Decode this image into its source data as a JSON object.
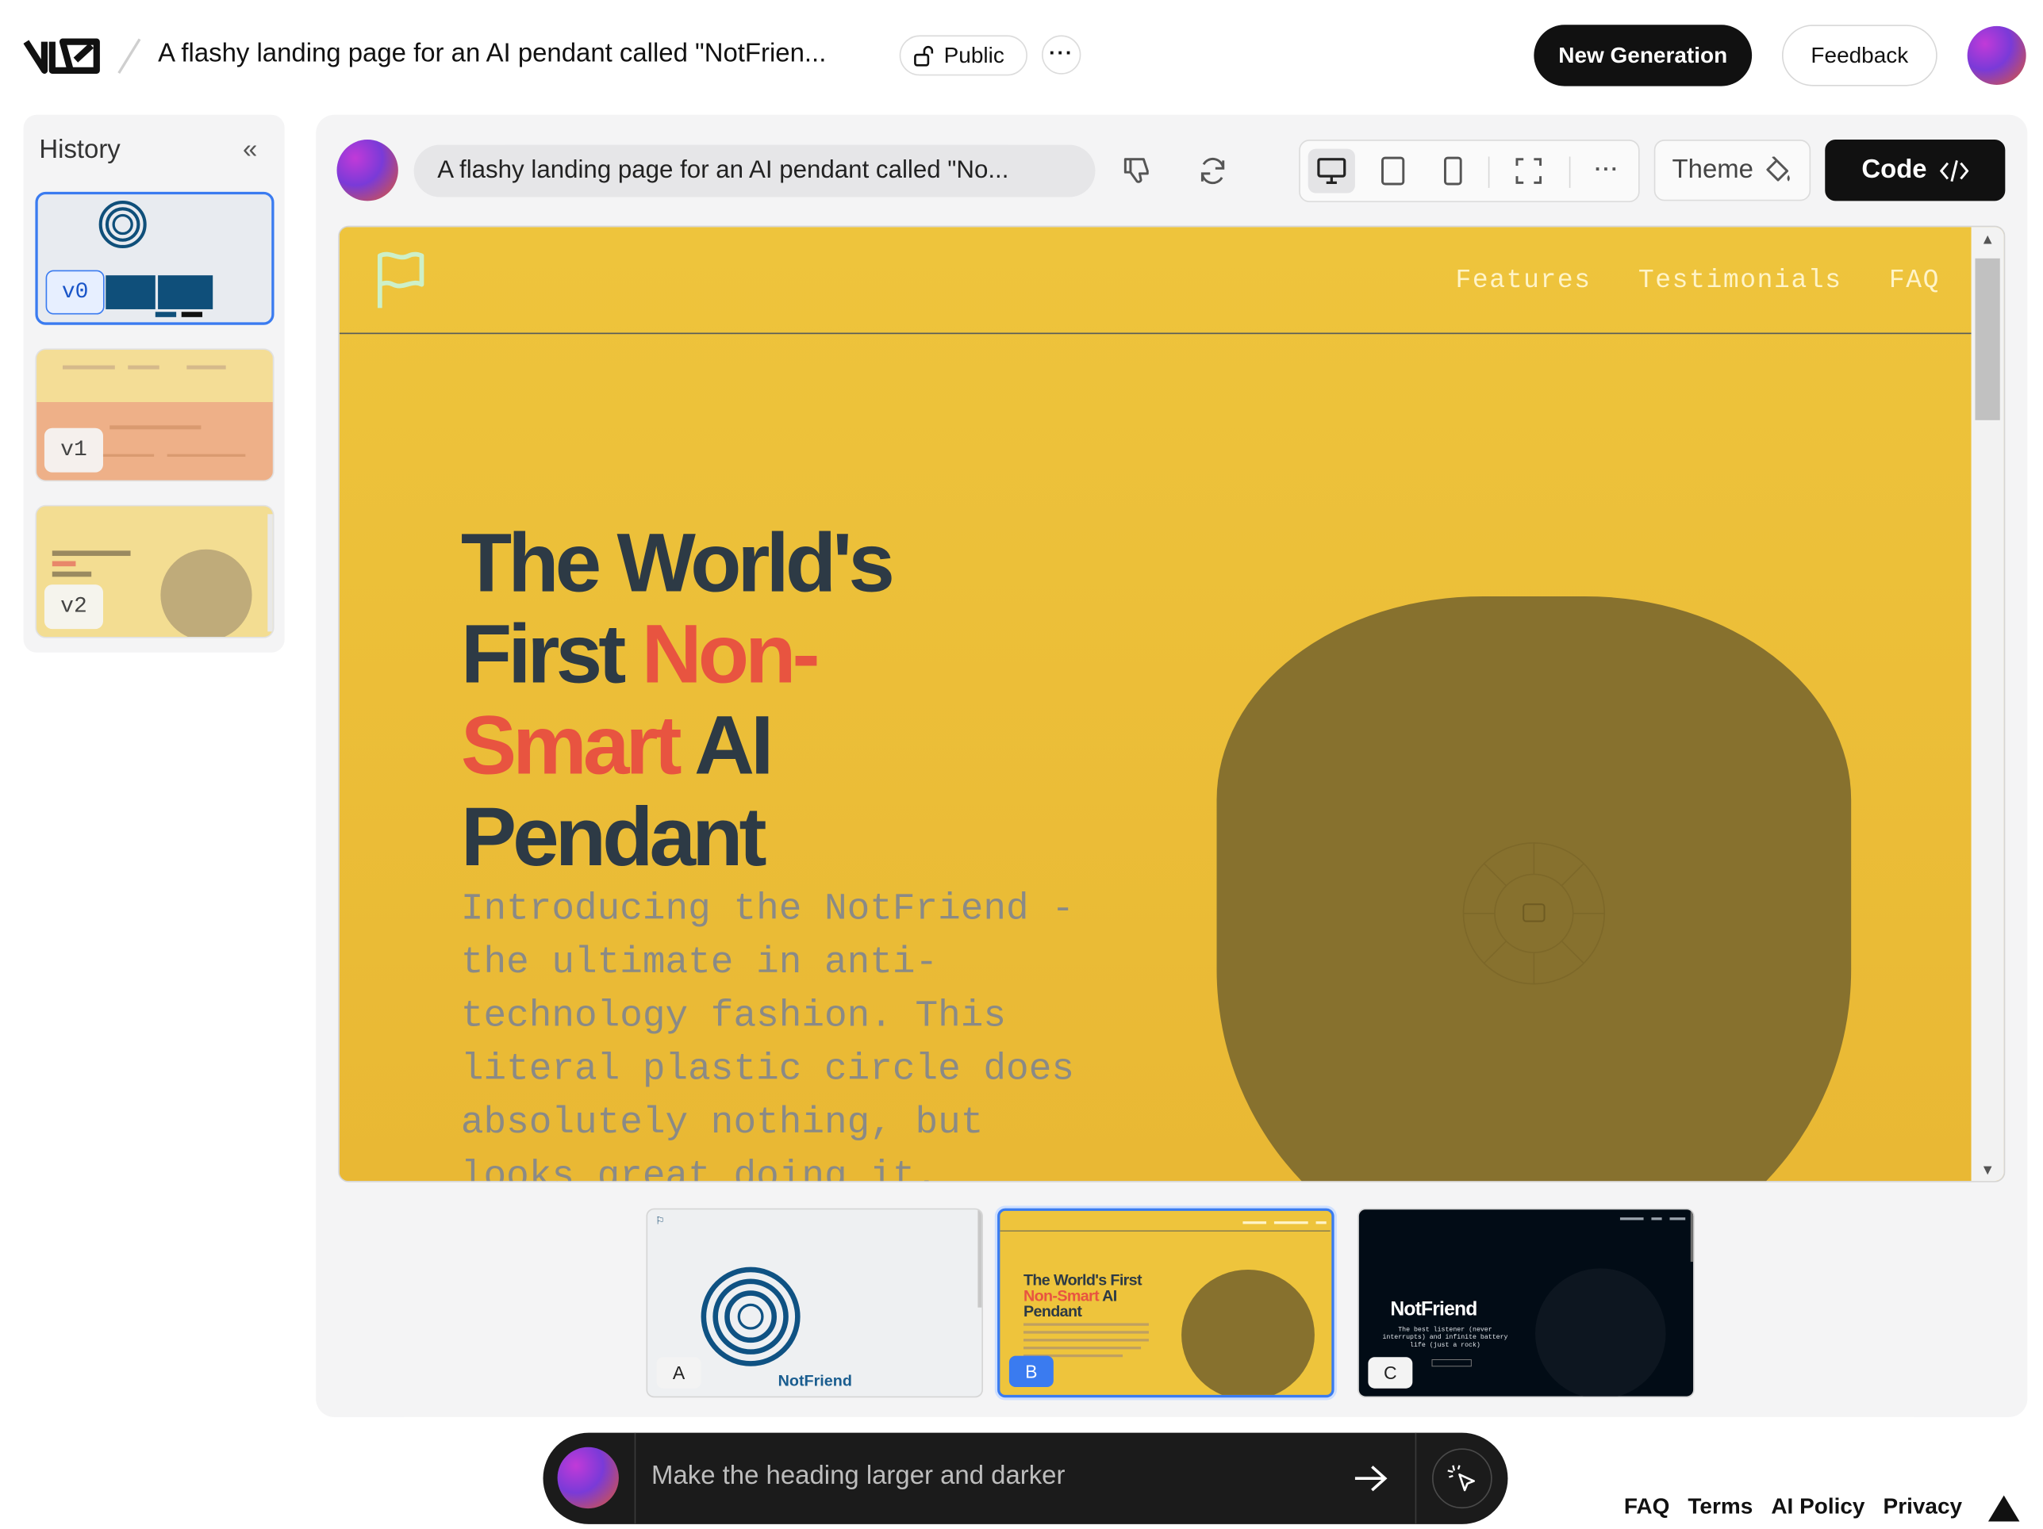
{
  "header": {
    "project_title": "A flashy landing page for an AI pendant called \"NotFrien...",
    "visibility_label": "Public",
    "new_generation_label": "New Generation",
    "feedback_label": "Feedback"
  },
  "history": {
    "title": "History",
    "versions": [
      {
        "label": "v0",
        "selected": true
      },
      {
        "label": "v1",
        "selected": false
      },
      {
        "label": "v2",
        "selected": false
      }
    ]
  },
  "toolbar": {
    "prompt_text": "A flashy landing page for an AI pendant called \"No...",
    "theme_label": "Theme",
    "code_label": "Code"
  },
  "preview": {
    "nav_links": [
      "Features",
      "Testimonials",
      "FAQ"
    ],
    "heading_part1": "The World's First ",
    "heading_highlight": "Non-Smart",
    "heading_part2": " AI Pendant",
    "description": "Introducing the NotFriend - the ultimate in anti-technology fashion. This literal plastic circle does absolutely nothing, but looks great doing it."
  },
  "variants": [
    {
      "label": "A",
      "selected": false,
      "brand": "NotFriend"
    },
    {
      "label": "B",
      "selected": true,
      "heading1": "The World's First",
      "heading_hl": "Non-Smart",
      "heading2": "AI",
      "heading3": "Pendant"
    },
    {
      "label": "C",
      "selected": false,
      "brand": "NotFriend",
      "tagline": "The best listener (never interrupts) and infinite battery life (just a rock)"
    }
  ],
  "chat": {
    "placeholder": "Make the heading larger and darker"
  },
  "footer": {
    "links": [
      "FAQ",
      "Terms",
      "AI Policy",
      "Privacy"
    ]
  },
  "colors": {
    "accent_blue": "#3a7bf0",
    "preview_yellow": "#eec43c",
    "heading_dark": "#2d3a45",
    "heading_highlight": "#e85440",
    "blob": "#87712e"
  }
}
